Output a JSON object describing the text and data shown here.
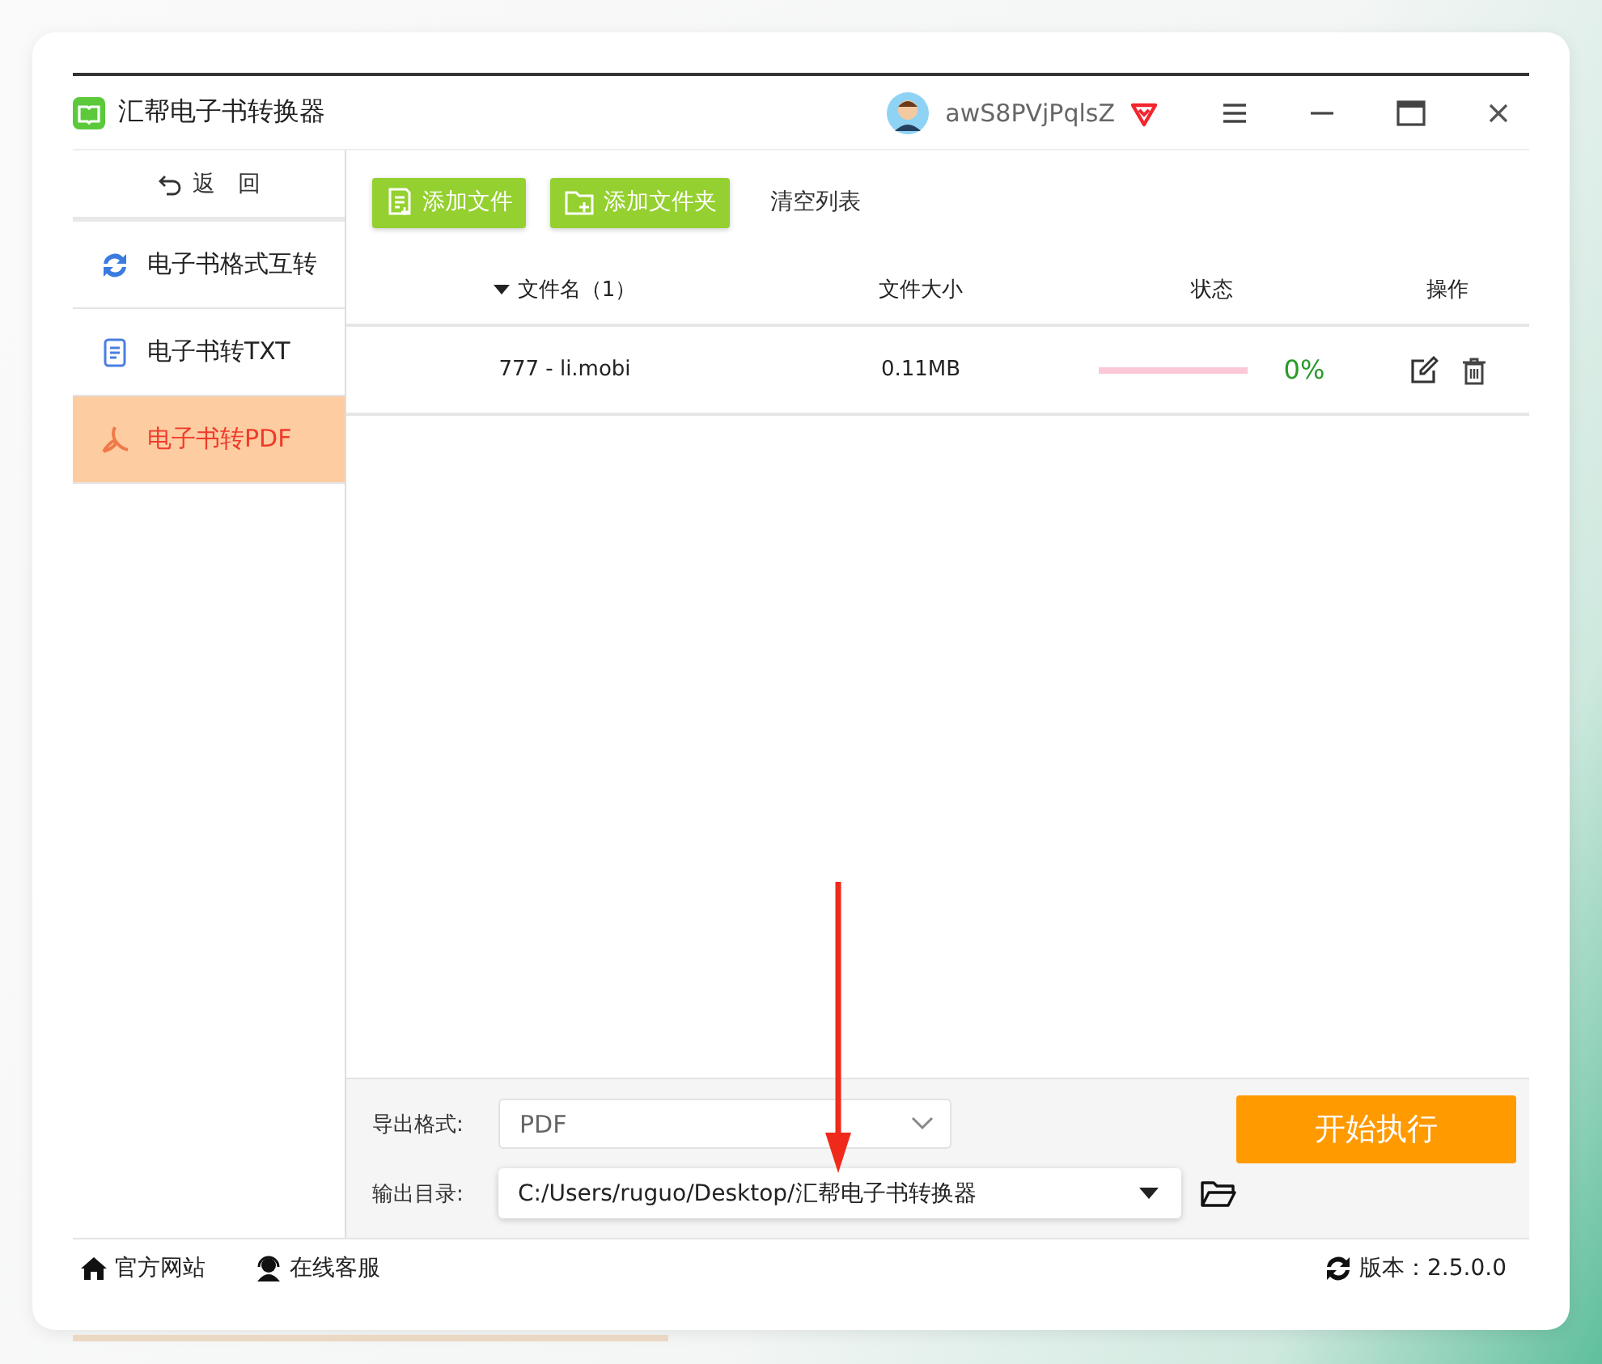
{
  "window": {
    "title": "汇帮电子书转换器",
    "username": "awS8PVjPqlsZ"
  },
  "sidebar": {
    "back": "返　回",
    "items": [
      {
        "label": "电子书格式互转",
        "kind": "convert",
        "selected": false
      },
      {
        "label": "电子书转TXT",
        "kind": "txt",
        "selected": false
      },
      {
        "label": "电子书转PDF",
        "kind": "pdf",
        "selected": true
      }
    ]
  },
  "toolbar": {
    "add_file": "添加文件",
    "add_folder": "添加文件夹",
    "clear": "清空列表"
  },
  "table": {
    "columns": [
      "文件名（1）",
      "文件大小",
      "状态",
      "操作"
    ],
    "rows": [
      {
        "name": "777 - li.mobi",
        "size": "0.11MB",
        "level": 0,
        "percent": "0%"
      }
    ]
  },
  "output": {
    "format_label": "导出格式:",
    "format": "PDF",
    "dir_label": "输出目录:",
    "dir": "C:/Users/ruguo/Desktop/汇帮电子书转换器",
    "start": "开始执行"
  },
  "status_bar": {
    "website": "官方网站",
    "support": "在线客服",
    "version": "版本：2.5.0.0"
  }
}
